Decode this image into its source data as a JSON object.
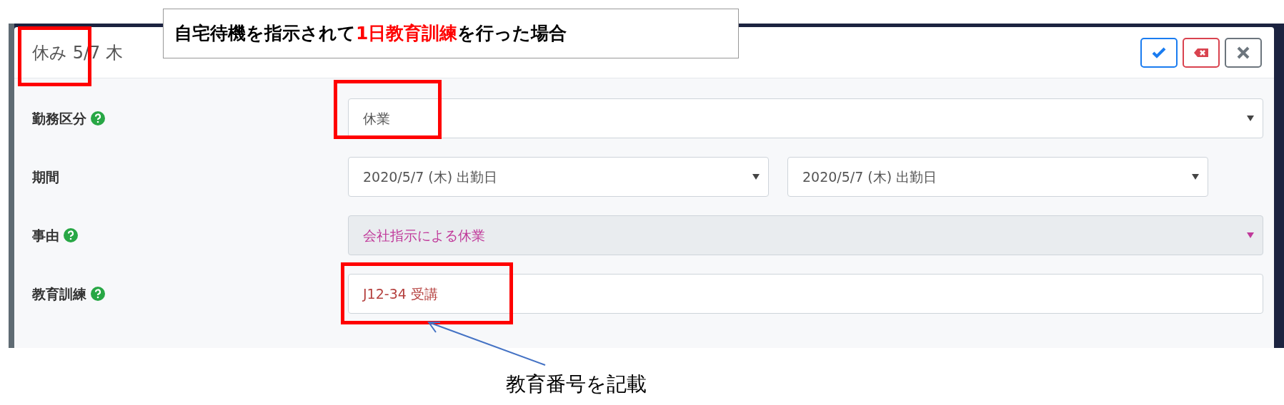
{
  "dialog": {
    "title": "休み 5/7 木",
    "buttons": [
      {
        "kind": "confirm"
      },
      {
        "kind": "delete"
      },
      {
        "kind": "close"
      }
    ],
    "rows": [
      {
        "label": "勤務区分",
        "help": true,
        "fields": [
          {
            "kind": "select",
            "value": "休業",
            "disabled": false
          }
        ]
      },
      {
        "label": "期間",
        "help": false,
        "fields": [
          {
            "kind": "select",
            "value": "2020/5/7 (木) 出勤日",
            "disabled": false
          },
          {
            "kind": "select",
            "value": "2020/5/7 (木) 出勤日",
            "disabled": false
          }
        ]
      },
      {
        "label": "事由",
        "help": true,
        "fields": [
          {
            "kind": "select",
            "value": "会社指示による休業",
            "disabled": true
          }
        ]
      },
      {
        "label": "教育訓練",
        "help": true,
        "fields": [
          {
            "kind": "text",
            "value": "J12-34 受講",
            "disabled": false
          }
        ]
      }
    ]
  },
  "annotation": {
    "callout": [
      {
        "text": "自宅待機を指示されて",
        "highlighted": false
      },
      {
        "text": "1日教育訓練",
        "highlighted": true
      },
      {
        "text": "を行った場合",
        "highlighted": false
      }
    ],
    "caption": "教育番号を記載"
  }
}
